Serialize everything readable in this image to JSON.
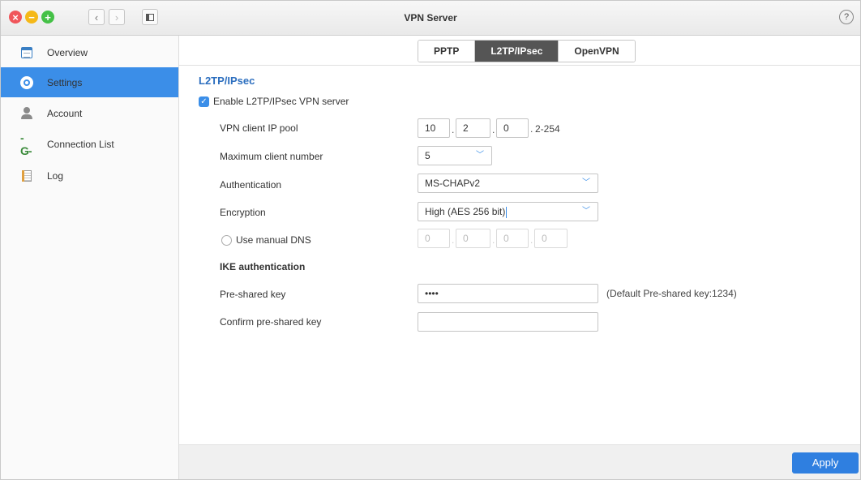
{
  "window": {
    "title": "VPN Server",
    "help_label": "?"
  },
  "sidebar": {
    "items": [
      {
        "label": "Overview",
        "icon": "overview-icon"
      },
      {
        "label": "Settings",
        "icon": "gear-icon",
        "active": true
      },
      {
        "label": "Account",
        "icon": "account-icon"
      },
      {
        "label": "Connection List",
        "icon": "connection-icon"
      },
      {
        "label": "Log",
        "icon": "log-icon"
      }
    ]
  },
  "tabs": [
    {
      "label": "PPTP"
    },
    {
      "label": "L2TP/IPsec",
      "active": true
    },
    {
      "label": "OpenVPN"
    }
  ],
  "form": {
    "section_title": "L2TP/IPsec",
    "enable_label": "Enable L2TP/IPsec VPN server",
    "enable_checked": true,
    "ip_pool": {
      "label": "VPN client IP pool",
      "octet1": "10",
      "octet2": "2",
      "octet3": "0",
      "range": "2-254"
    },
    "max_clients": {
      "label": "Maximum client number",
      "value": "5"
    },
    "authentication": {
      "label": "Authentication",
      "value": "MS-CHAPv2"
    },
    "encryption": {
      "label": "Encryption",
      "value": "High (AES 256 bit)"
    },
    "manual_dns": {
      "label": "Use manual DNS",
      "checked": false,
      "octets": [
        "0",
        "0",
        "0",
        "0"
      ]
    },
    "ike_title": "IKE authentication",
    "psk": {
      "label": "Pre-shared key",
      "value": "••••",
      "hint": "(Default Pre-shared key:1234)"
    },
    "confirm_psk": {
      "label": "Confirm pre-shared key",
      "value": ""
    }
  },
  "footer": {
    "apply_label": "Apply"
  },
  "colors": {
    "accent": "#3b8ee8",
    "section_title": "#2d6fbf",
    "active_tab": "#555555"
  }
}
